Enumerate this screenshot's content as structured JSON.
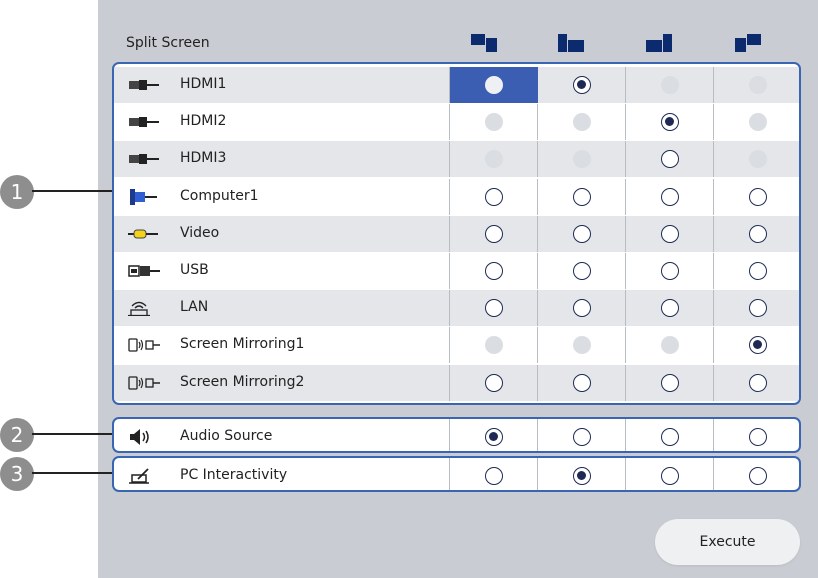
{
  "title": "Split Screen",
  "layouts": [
    {
      "icon": "layout-left-top-icon"
    },
    {
      "icon": "layout-left-large-icon"
    },
    {
      "icon": "layout-right-large-icon"
    },
    {
      "icon": "layout-right-top-icon"
    }
  ],
  "sources": [
    {
      "label": "HDMI1",
      "icon": "hdmi-icon",
      "states": [
        "focused",
        "selected",
        "disabled",
        "disabled"
      ]
    },
    {
      "label": "HDMI2",
      "icon": "hdmi-icon",
      "states": [
        "disabled",
        "disabled",
        "selected",
        "disabled"
      ]
    },
    {
      "label": "HDMI3",
      "icon": "hdmi-icon",
      "states": [
        "disabled",
        "disabled",
        "empty",
        "disabled"
      ]
    },
    {
      "label": "Computer1",
      "icon": "computer-vga-icon",
      "states": [
        "empty",
        "empty",
        "empty",
        "empty"
      ]
    },
    {
      "label": "Video",
      "icon": "video-rca-icon",
      "states": [
        "empty",
        "empty",
        "empty",
        "empty"
      ]
    },
    {
      "label": "USB",
      "icon": "usb-icon",
      "states": [
        "empty",
        "empty",
        "empty",
        "empty"
      ]
    },
    {
      "label": "LAN",
      "icon": "lan-icon",
      "states": [
        "empty",
        "empty",
        "empty",
        "empty"
      ]
    },
    {
      "label": "Screen Mirroring1",
      "icon": "screen-mirroring-icon",
      "states": [
        "disabled",
        "disabled",
        "disabled",
        "selected"
      ]
    },
    {
      "label": "Screen Mirroring2",
      "icon": "screen-mirroring-icon",
      "states": [
        "empty",
        "empty",
        "empty",
        "empty"
      ]
    }
  ],
  "audio_source": {
    "label": "Audio Source",
    "icon": "speaker-icon",
    "states": [
      "selected",
      "empty",
      "empty",
      "empty"
    ]
  },
  "pc_interactivity": {
    "label": "PC Interactivity",
    "icon": "pen-tablet-icon",
    "states": [
      "empty",
      "selected",
      "empty",
      "empty"
    ]
  },
  "callouts": [
    "1",
    "2",
    "3"
  ],
  "execute_label": "Execute",
  "colors": {
    "panel": "#c9ccd2",
    "group_border": "#3a65b2",
    "focus": "#3b5eb3",
    "alt_row": "#e4e6e9",
    "callout": "#8e8e8e"
  }
}
